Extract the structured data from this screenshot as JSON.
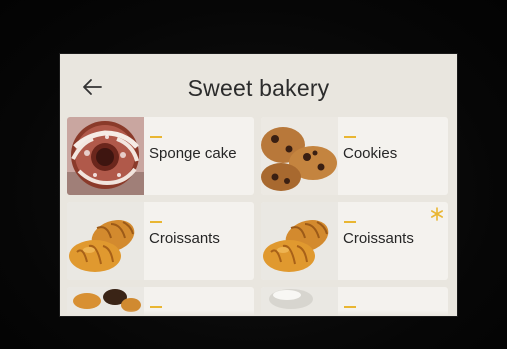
{
  "header": {
    "title": "Sweet bakery",
    "back_icon": "back-arrow-icon"
  },
  "accent_color": "#e9b632",
  "products": [
    {
      "label": "Sponge cake",
      "image": "bundt-cake-image"
    },
    {
      "label": "Cookies",
      "image": "cookies-image"
    },
    {
      "label": "Croissants",
      "image": "croissants-image"
    },
    {
      "label": "Croissants",
      "image": "croissants-image",
      "badge": "snowflake-icon"
    },
    {
      "label": "",
      "image": "pastries-image"
    },
    {
      "label": "",
      "image": "cream-image"
    }
  ]
}
